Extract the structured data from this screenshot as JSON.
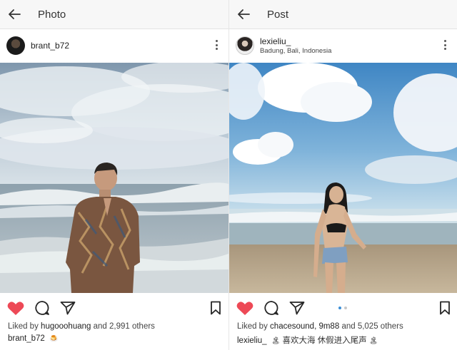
{
  "left": {
    "title": "Photo",
    "username": "brant_b72",
    "liked_by_prefix": "Liked by",
    "liked_by_user": "hugooohuang",
    "liked_by_suffix": "and 2,991 others",
    "caption_user": "brant_b72",
    "caption_text": "",
    "caption_emoji": "🍮"
  },
  "right": {
    "title": "Post",
    "username": "lexieliu_",
    "location": "Badung, Bali, Indonesia",
    "liked_by_prefix": "Liked by",
    "liked_by_user": "chacesound, 9m88",
    "liked_by_suffix": "and 5,025 others",
    "caption_user": "lexieliu_",
    "caption_text": "喜欢大海 休假进入尾声",
    "caption_emoji_pre": "🏝",
    "caption_emoji_post": "🏝",
    "carousel_pages": 2,
    "carousel_active": 1
  },
  "colors": {
    "heart": "#ed4956",
    "carousel_active": "#3b8fd6",
    "icon": "#262626"
  }
}
